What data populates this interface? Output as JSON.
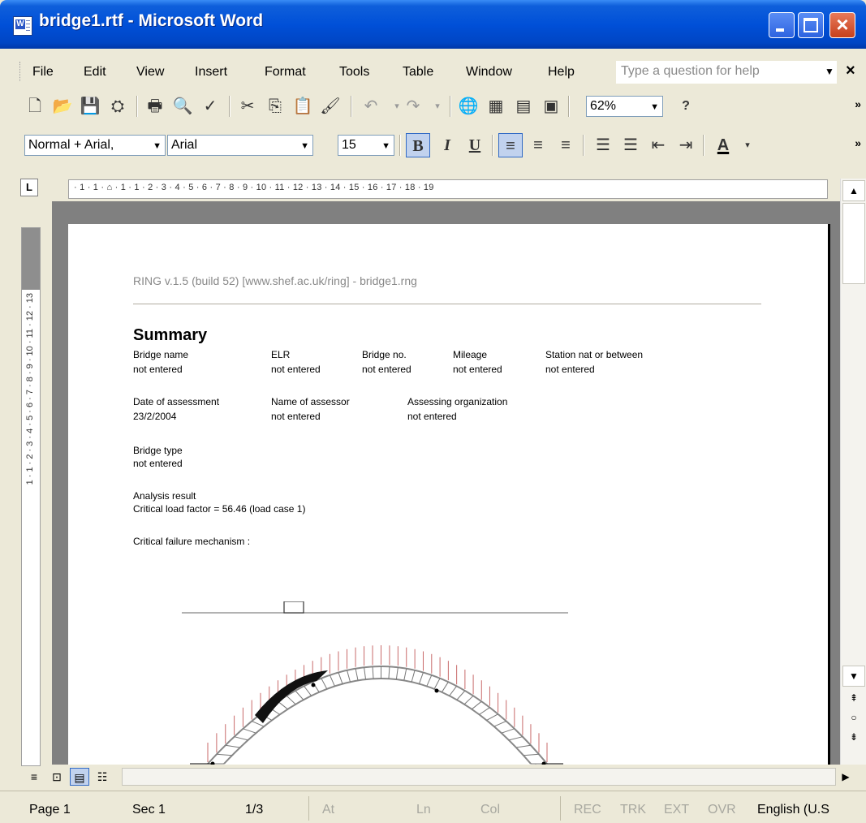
{
  "window": {
    "title": "bridge1.rtf - Microsoft Word"
  },
  "menu": [
    "File",
    "Edit",
    "View",
    "Insert",
    "Format",
    "Tools",
    "Table",
    "Window",
    "Help"
  ],
  "help_box": {
    "placeholder": "Type a question for help"
  },
  "toolbar": {
    "zoom": "62%"
  },
  "format_toolbar": {
    "style": "Normal + Arial,",
    "font": "Arial",
    "size": "15"
  },
  "ruler": {
    "tab_selector": "L",
    "h_numbers": "· 1 · 1 · ⌂ · 1 · 1 · 2 · 3 · 4 · 5 · 6 · 7 · 8 · 9 · 10 · 11 · 12 · 13 · 14 · 15 · 16 · 17 · 18 · 19",
    "v_numbers": "1 · 1 · 2 · 3 · 4 · 5 · 6 · 7 · 8 · 9 · 10 · 11 · 12 · 13"
  },
  "document": {
    "header": "RING v.1.5 (build 52) [www.shef.ac.uk/ring] - bridge1.rng",
    "summary_heading": "Summary",
    "row1": {
      "labels": [
        "Bridge name",
        "ELR",
        "Bridge no.",
        "Mileage",
        "Station nat or between"
      ],
      "values": [
        "not entered",
        "not entered",
        "not entered",
        "not entered",
        "not entered"
      ]
    },
    "row2": {
      "labels": [
        "Date of assessment",
        "Name of assessor",
        "Assessing organization"
      ],
      "values": [
        "23/2/2004",
        "not entered",
        "not entered"
      ]
    },
    "bridge_type_label": "Bridge type",
    "bridge_type_value": "not entered",
    "analysis_label": "Analysis result",
    "analysis_value": "Critical load factor = 56.46 (load case 1)",
    "mechanism_label": "Critical failure mechanism :"
  },
  "status": {
    "page": "Page 1",
    "sec": "Sec 1",
    "pages": "1/3",
    "at": "At",
    "ln": "Ln",
    "col": "Col",
    "rec": "REC",
    "trk": "TRK",
    "ext": "EXT",
    "ovr": "OVR",
    "language": "English (U.S"
  }
}
